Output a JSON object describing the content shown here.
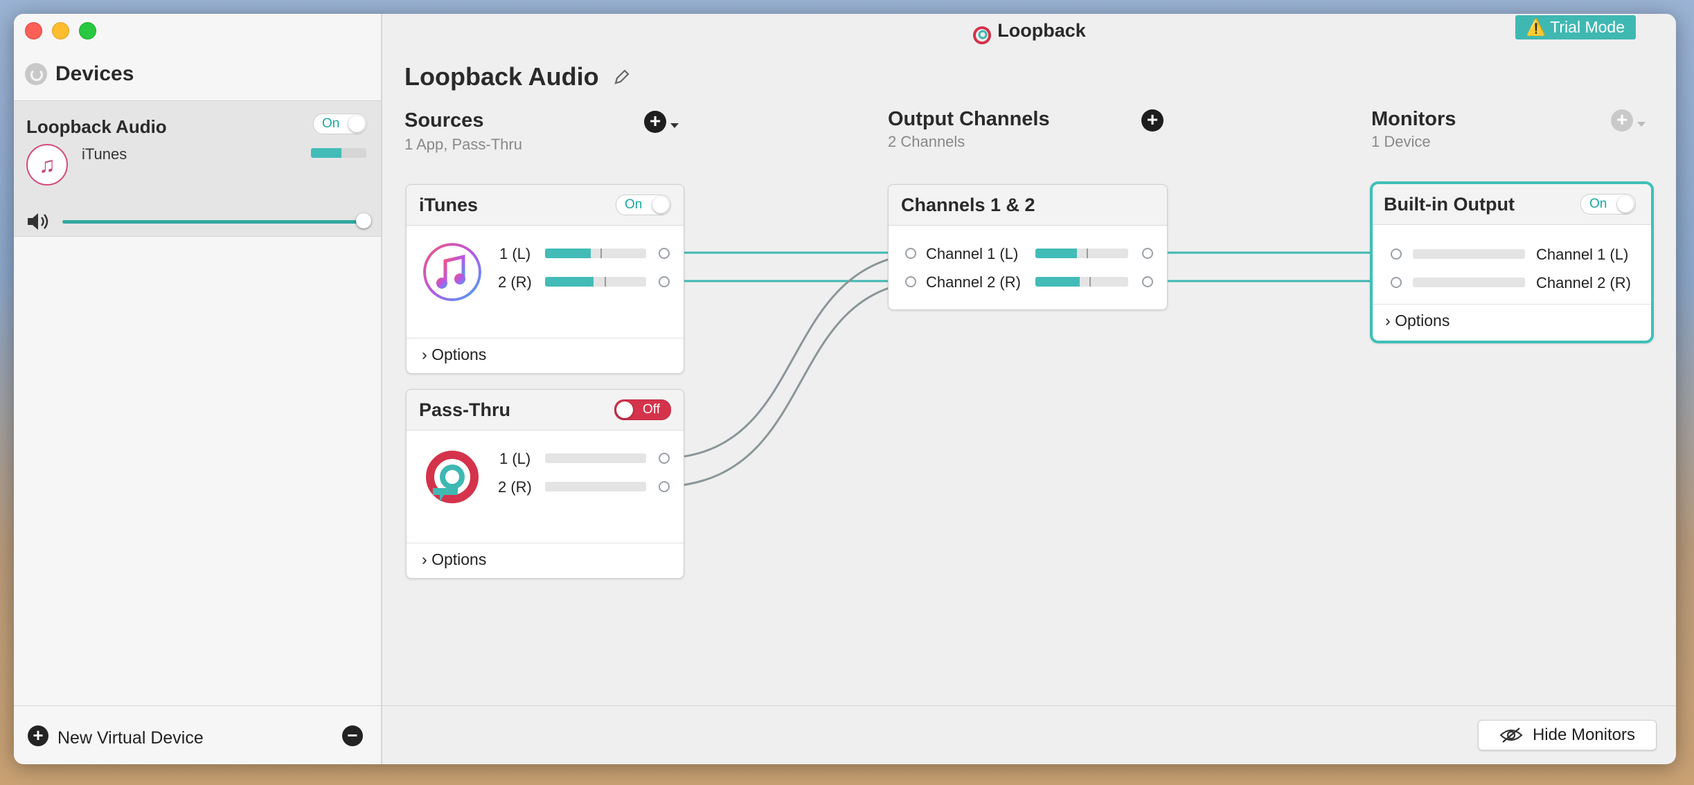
{
  "window": {
    "title": "Loopback",
    "trial_badge": "⚠️ Trial Mode"
  },
  "sidebar": {
    "title": "Devices",
    "devices": [
      {
        "name": "Loopback Audio",
        "toggle": "On",
        "app": "iTunes",
        "meter_level": 0.55,
        "volume": 1.0
      }
    ],
    "footer": {
      "new_device_label": "New Virtual Device"
    }
  },
  "main": {
    "device_title": "Loopback Audio",
    "sources": {
      "heading": "Sources",
      "subtitle": "1 App, Pass-Thru"
    },
    "output": {
      "heading": "Output Channels",
      "subtitle": "2 Channels"
    },
    "monitors": {
      "heading": "Monitors",
      "subtitle": "1 Device"
    },
    "cards": {
      "itunes": {
        "title": "iTunes",
        "toggle": "On",
        "ch1": "1 (L)",
        "ch2": "2 (R)",
        "options": "Options",
        "levels": [
          0.45,
          0.48
        ]
      },
      "passthru": {
        "title": "Pass-Thru",
        "toggle": "Off",
        "ch1": "1 (L)",
        "ch2": "2 (R)",
        "options": "Options",
        "levels": [
          0,
          0
        ]
      },
      "channels": {
        "title": "Channels 1 & 2",
        "ch1": "Channel 1 (L)",
        "ch2": "Channel 2 (R)",
        "levels": [
          0.45,
          0.48
        ]
      },
      "builtin": {
        "title": "Built-in Output",
        "toggle": "On",
        "ch1": "Channel 1 (L)",
        "ch2": "Channel 2 (R)",
        "options": "Options",
        "levels": [
          0,
          0
        ]
      }
    },
    "footer": {
      "hide_monitors_label": "Hide Monitors"
    }
  },
  "colors": {
    "accent": "#3ec0b9",
    "off_red": "#d4334b",
    "wire_active": "#3fb8b2",
    "wire_inactive": "#8a9699"
  }
}
